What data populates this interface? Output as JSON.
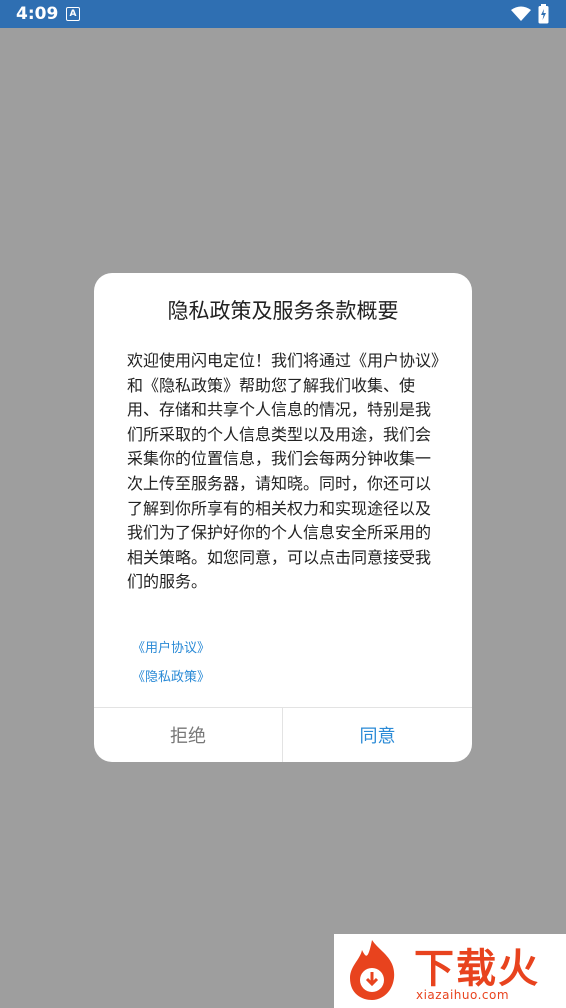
{
  "status_bar": {
    "time": "4:09",
    "a_icon": "A"
  },
  "dialog": {
    "title": "隐私政策及服务条款概要",
    "body": "欢迎使用闪电定位！我们将通过《用户协议》和《隐私政策》帮助您了解我们收集、使用、存储和共享个人信息的情况，特别是我们所采取的个人信息类型以及用途，我们会采集你的位置信息，我们会每两分钟收集一次上传至服务器，请知晓。同时，你还可以了解到你所享有的相关权力和实现途径以及我们为了保护好你的个人信息安全所采用的相关策略。如您同意，可以点击同意接受我们的服务。",
    "user_agreement_link": "《用户协议》",
    "privacy_policy_link": "《隐私政策》",
    "reject_label": "拒绝",
    "agree_label": "同意"
  },
  "watermark": {
    "brand": "下载火",
    "url": "xiazaihuo.com"
  },
  "colors": {
    "status_bar": "#2f6fb2",
    "overlay": "#9e9e9e",
    "link": "#2a8ad6",
    "brand": "#e8431e"
  }
}
